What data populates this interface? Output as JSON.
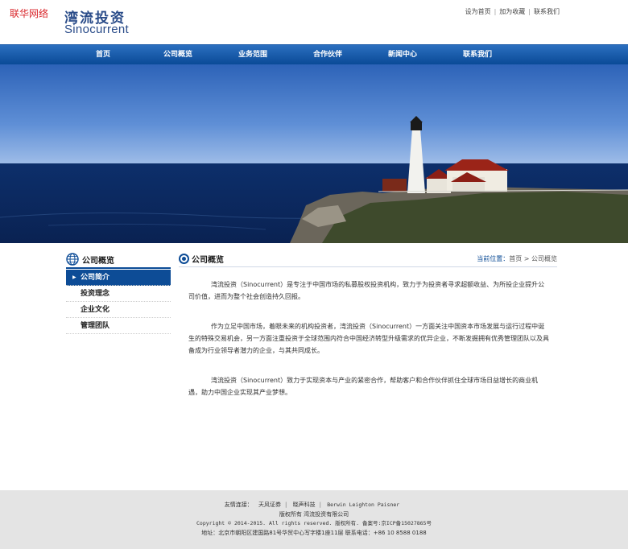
{
  "watermark": "联华网络",
  "logo": {
    "cn": "湾流投资",
    "en": "Sinocurrent"
  },
  "toplinks": [
    "设为首页",
    "加为收藏",
    "联系我们"
  ],
  "nav": [
    "首页",
    "公司概览",
    "业务范围",
    "合作伙伴",
    "新闻中心",
    "联系我们"
  ],
  "sidebar": {
    "title": "公司概览",
    "items": [
      "公司简介",
      "投资理念",
      "企业文化",
      "管理团队"
    ]
  },
  "main": {
    "title": "公司概览",
    "breadcrumb_prefix": "当前位置：",
    "breadcrumb_home": "首页",
    "breadcrumb_sep": ">",
    "breadcrumb_here": "公司概览",
    "paragraphs": [
      "湾流投资（Sinocurrent）是专注于中国市场的私募股权投资机构，致力于为投资者寻求超额收益、为所投企业提升公司价值，进而为整个社会创造持久回报。",
      "作为立足中国市场，着眼未来的机构投资者，湾流投资（Sinocurrent）一方面关注中国资本市场发展与运行过程中诞生的特殊交易机会，另一方面注重投资于全球范围内符合中国经济转型升级需求的优异企业，不断发掘拥有优秀管理团队以及具备成为行业领导者潜力的企业，与其共同成长。",
      "湾流投资（Sinocurrent）致力于实现资本与产业的紧密合作，帮助客户和合作伙伴抓住全球市场日益增长的商业机遇，助力中国企业实现其产业梦想。"
    ]
  },
  "footer": {
    "links_label": "友情连接：",
    "links": [
      "天风证券",
      "晓声科技",
      "Berwin Leighton Paisner"
    ],
    "copyright_owner": "版权所有 湾流投资有限公司",
    "copyright_line": "Copyright © 2014-2015. All rights reserved. 版权所有. 备案号:京ICP备15027865号",
    "address_line": "地址：北京市朝阳区建国路81号华贸中心写字楼1座11层 联系电话：+86 10 8588 0188"
  },
  "colors": {
    "nav_blue": "#0d4c96",
    "logo_blue": "#2a4c89",
    "watermark_red": "#d9262b",
    "footer_bg": "#e4e4e4"
  }
}
